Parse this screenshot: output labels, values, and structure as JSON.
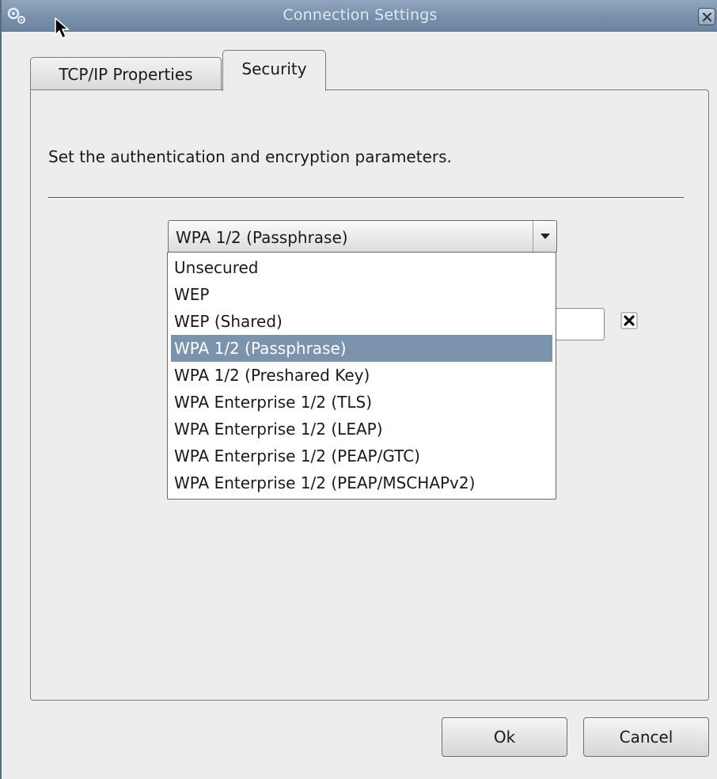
{
  "window": {
    "title": "Connection Settings",
    "icon": "gears-icon",
    "close_icon": "close-icon"
  },
  "tabs": [
    {
      "label": "TCP/IP Properties",
      "active": false
    },
    {
      "label": "Security",
      "active": true
    }
  ],
  "security": {
    "description": "Set the authentication and encryption parameters.",
    "mode": {
      "selected": "WPA 1/2 (Passphrase)",
      "options": [
        "Unsecured",
        "WEP",
        "WEP (Shared)",
        "WPA 1/2 (Passphrase)",
        "WPA 1/2 (Preshared Key)",
        "WPA Enterprise 1/2 (TLS)",
        "WPA Enterprise 1/2 (LEAP)",
        "WPA Enterprise 1/2 (PEAP/GTC)",
        "WPA Enterprise 1/2 (PEAP/MSCHAPv2)"
      ]
    },
    "clear_icon": "clear-x-icon"
  },
  "buttons": {
    "ok": "Ok",
    "cancel": "Cancel"
  },
  "colors": {
    "titlebar": "#7890aa",
    "selection": "#7b93ad",
    "window_bg": "#ededed"
  }
}
